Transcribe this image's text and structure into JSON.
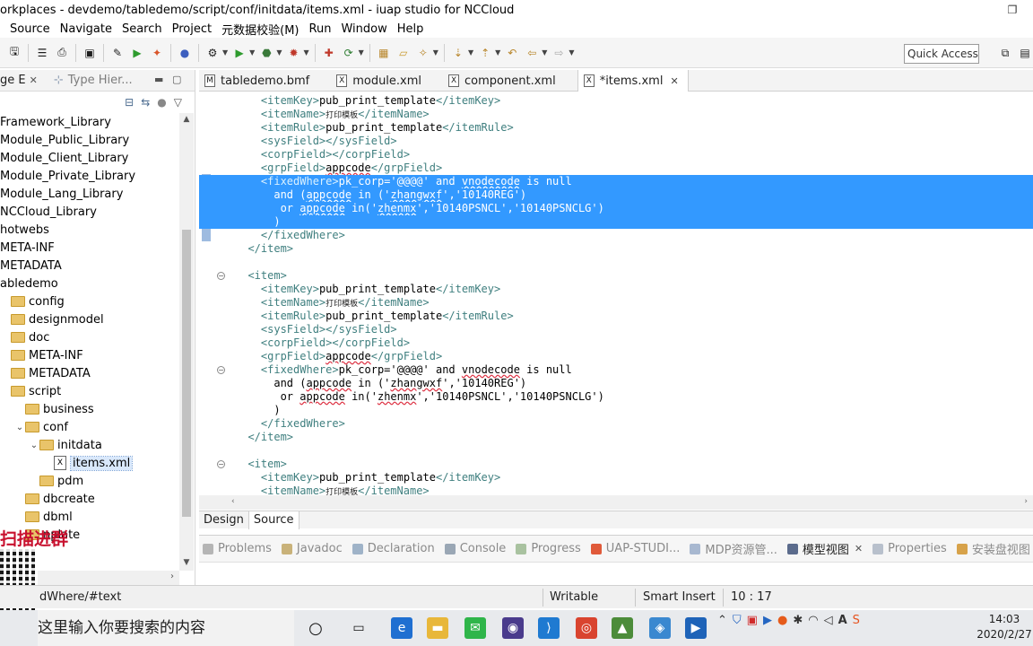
{
  "window": {
    "title": "orkplaces - devdemo/tabledemo/script/conf/initdata/items.xml - iuap studio for NCCloud",
    "restore_icon": "restore-icon"
  },
  "menu": [
    "Source",
    "Navigate",
    "Search",
    "Project",
    "元数据校验(M)",
    "Run",
    "Window",
    "Help"
  ],
  "toolbar": {
    "quick_access": "Quick Access"
  },
  "left_panel": {
    "tabs": [
      {
        "label": "ge E",
        "active": true
      },
      {
        "label": "Type Hier...",
        "active": false
      }
    ],
    "tree": [
      {
        "label": "Framework_Library",
        "indent": 0,
        "type": "lib"
      },
      {
        "label": "Module_Public_Library",
        "indent": 0,
        "type": "lib"
      },
      {
        "label": "Module_Client_Library",
        "indent": 0,
        "type": "lib"
      },
      {
        "label": "Module_Private_Library",
        "indent": 0,
        "type": "lib"
      },
      {
        "label": "Module_Lang_Library",
        "indent": 0,
        "type": "lib"
      },
      {
        "label": "NCCloud_Library",
        "indent": 0,
        "type": "lib"
      },
      {
        "label": "hotwebs",
        "indent": 0,
        "type": "lib"
      },
      {
        "label": "META-INF",
        "indent": 0,
        "type": "lib"
      },
      {
        "label": "METADATA",
        "indent": 0,
        "type": "lib"
      },
      {
        "label": "abledemo",
        "indent": 0,
        "type": "lib"
      },
      {
        "label": "config",
        "indent": 1,
        "type": "folder"
      },
      {
        "label": "designmodel",
        "indent": 1,
        "type": "folder"
      },
      {
        "label": "doc",
        "indent": 1,
        "type": "folder"
      },
      {
        "label": "META-INF",
        "indent": 1,
        "type": "folder"
      },
      {
        "label": "METADATA",
        "indent": 1,
        "type": "folder"
      },
      {
        "label": "script",
        "indent": 1,
        "type": "folder"
      },
      {
        "label": "business",
        "indent": 2,
        "type": "folder"
      },
      {
        "label": "conf",
        "indent": 2,
        "type": "folder-open"
      },
      {
        "label": "initdata",
        "indent": 3,
        "type": "folder-open"
      },
      {
        "label": "items.xml",
        "indent": 4,
        "type": "xml",
        "selected": true
      },
      {
        "label": "pdm",
        "indent": 3,
        "type": "folder"
      },
      {
        "label": "dbcreate",
        "indent": 2,
        "type": "folder"
      },
      {
        "label": "dbml",
        "indent": 2,
        "type": "folder"
      },
      {
        "label": "nplate",
        "indent": 2,
        "type": "folder"
      }
    ]
  },
  "promo_text": "扫描进群",
  "editor": {
    "tabs": [
      {
        "label": "tabledemo.bmf",
        "icon": "M",
        "active": false,
        "closable": false
      },
      {
        "label": "module.xml",
        "icon": "X",
        "active": false,
        "closable": false
      },
      {
        "label": "component.xml",
        "icon": "X",
        "active": false,
        "closable": false
      },
      {
        "label": "*items.xml",
        "icon": "X",
        "active": true,
        "closable": true
      }
    ],
    "lines": [
      {
        "indent": "    ",
        "parts": [
          [
            "tag",
            "<itemKey>"
          ],
          [
            "txt",
            "pub_print_template"
          ],
          [
            "tag",
            "</itemKey>"
          ]
        ]
      },
      {
        "indent": "    ",
        "parts": [
          [
            "tag",
            "<itemName>"
          ],
          [
            "cjk",
            "打印模板"
          ],
          [
            "tag",
            "</itemName>"
          ]
        ]
      },
      {
        "indent": "    ",
        "parts": [
          [
            "tag",
            "<itemRule>"
          ],
          [
            "txt",
            "pub_print_template"
          ],
          [
            "tag",
            "</itemRule>"
          ]
        ]
      },
      {
        "indent": "    ",
        "parts": [
          [
            "tag",
            "<sysField></sysField>"
          ]
        ]
      },
      {
        "indent": "    ",
        "parts": [
          [
            "tag",
            "<corpField></corpField>"
          ]
        ]
      },
      {
        "indent": "    ",
        "parts": [
          [
            "tag",
            "<grpField>"
          ],
          [
            "sq",
            "appcode"
          ],
          [
            "tag",
            "</grpField>"
          ]
        ]
      },
      {
        "indent": "    ",
        "sel": true,
        "parts": [
          [
            "tag",
            "<fixedWhere>"
          ],
          [
            "txt",
            "pk_corp='@@@@' and "
          ],
          [
            "sq",
            "vnodecode"
          ],
          [
            "txt",
            " is null"
          ]
        ]
      },
      {
        "indent": "      ",
        "sel": true,
        "parts": [
          [
            "txt",
            "and ("
          ],
          [
            "sq",
            "appcode"
          ],
          [
            "txt",
            " in ('"
          ],
          [
            "sq",
            "zhangwxf"
          ],
          [
            "txt",
            "','10140REG')"
          ]
        ]
      },
      {
        "indent": "       ",
        "sel": true,
        "parts": [
          [
            "txt",
            "or "
          ],
          [
            "sq",
            "appcode"
          ],
          [
            "txt",
            " in('"
          ],
          [
            "sq",
            "zhenmx"
          ],
          [
            "txt",
            "','10140PSNCL','10140PSNCLG')"
          ]
        ]
      },
      {
        "indent": "      ",
        "sel": true,
        "parts": [
          [
            "txt",
            ")"
          ]
        ]
      },
      {
        "indent": "    ",
        "parts": [
          [
            "tag",
            "</fixedWhere>"
          ]
        ]
      },
      {
        "indent": "  ",
        "parts": [
          [
            "tag",
            "</item>"
          ]
        ]
      },
      {
        "indent": "",
        "parts": []
      },
      {
        "indent": "  ",
        "parts": [
          [
            "tag",
            "<item>"
          ]
        ]
      },
      {
        "indent": "    ",
        "parts": [
          [
            "tag",
            "<itemKey>"
          ],
          [
            "txt",
            "pub_print_template"
          ],
          [
            "tag",
            "</itemKey>"
          ]
        ]
      },
      {
        "indent": "    ",
        "parts": [
          [
            "tag",
            "<itemName>"
          ],
          [
            "cjk",
            "打印模板"
          ],
          [
            "tag",
            "</itemName>"
          ]
        ]
      },
      {
        "indent": "    ",
        "parts": [
          [
            "tag",
            "<itemRule>"
          ],
          [
            "txt",
            "pub_print_template"
          ],
          [
            "tag",
            "</itemRule>"
          ]
        ]
      },
      {
        "indent": "    ",
        "parts": [
          [
            "tag",
            "<sysField></sysField>"
          ]
        ]
      },
      {
        "indent": "    ",
        "parts": [
          [
            "tag",
            "<corpField></corpField>"
          ]
        ]
      },
      {
        "indent": "    ",
        "parts": [
          [
            "tag",
            "<grpField>"
          ],
          [
            "sq",
            "appcode"
          ],
          [
            "tag",
            "</grpField>"
          ]
        ]
      },
      {
        "indent": "    ",
        "parts": [
          [
            "tag",
            "<fixedWhere>"
          ],
          [
            "txt",
            "pk_corp='@@@@' and "
          ],
          [
            "sq",
            "vnodecode"
          ],
          [
            "txt",
            " is null"
          ]
        ]
      },
      {
        "indent": "      ",
        "parts": [
          [
            "txt",
            "and ("
          ],
          [
            "sq",
            "appcode"
          ],
          [
            "txt",
            " in ('"
          ],
          [
            "sq",
            "zhangwxf"
          ],
          [
            "txt",
            "','10140REG')"
          ]
        ]
      },
      {
        "indent": "       ",
        "parts": [
          [
            "txt",
            "or "
          ],
          [
            "sq",
            "appcode"
          ],
          [
            "txt",
            " in('"
          ],
          [
            "sq",
            "zhenmx"
          ],
          [
            "txt",
            "','10140PSNCL','10140PSNCLG')"
          ]
        ]
      },
      {
        "indent": "      ",
        "parts": [
          [
            "txt",
            ")"
          ]
        ]
      },
      {
        "indent": "    ",
        "parts": [
          [
            "tag",
            "</fixedWhere>"
          ]
        ]
      },
      {
        "indent": "  ",
        "parts": [
          [
            "tag",
            "</item>"
          ]
        ]
      },
      {
        "indent": "",
        "parts": []
      },
      {
        "indent": "  ",
        "parts": [
          [
            "tag",
            "<item>"
          ]
        ]
      },
      {
        "indent": "    ",
        "parts": [
          [
            "tag",
            "<itemKey>"
          ],
          [
            "txt",
            "pub_print_template"
          ],
          [
            "tag",
            "</itemKey>"
          ]
        ]
      },
      {
        "indent": "    ",
        "parts": [
          [
            "tag",
            "<itemName>"
          ],
          [
            "cjk",
            "打印模板"
          ],
          [
            "tag",
            "</itemName>"
          ]
        ]
      }
    ],
    "design_source_tabs": [
      {
        "label": "Design",
        "active": false
      },
      {
        "label": "Source",
        "active": true
      }
    ]
  },
  "bottom_views": [
    {
      "label": "Problems",
      "active": false,
      "icon": "problems-icon"
    },
    {
      "label": "Javadoc",
      "active": false,
      "icon": "javadoc-icon"
    },
    {
      "label": "Declaration",
      "active": false,
      "icon": "declaration-icon"
    },
    {
      "label": "Console",
      "active": false,
      "icon": "console-icon"
    },
    {
      "label": "Progress",
      "active": false,
      "icon": "progress-icon"
    },
    {
      "label": "UAP-STUDI...",
      "active": false,
      "icon": "uap-icon"
    },
    {
      "label": "MDP资源管...",
      "active": false,
      "icon": "mdp-icon"
    },
    {
      "label": "模型视图",
      "active": true,
      "icon": "model-view-icon"
    },
    {
      "label": "Properties",
      "active": false,
      "icon": "properties-icon"
    },
    {
      "label": "安装盘视图",
      "active": false,
      "icon": "install-disk-icon"
    }
  ],
  "status": {
    "path": "dWhere/#text",
    "writable": "Writable",
    "insert_mode": "Smart Insert",
    "position": "10 : 17"
  },
  "taskbar": {
    "search_placeholder": "这里输入你要搜索的内容",
    "time": "14:03",
    "date": "2020/2/27"
  }
}
